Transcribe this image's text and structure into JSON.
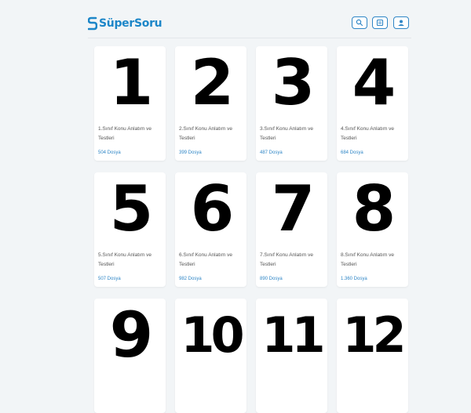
{
  "header": {
    "logo": "SüperSoru",
    "icons": [
      "search-icon",
      "document-icon",
      "user-icon"
    ],
    "accent_color": "#2f86c6"
  },
  "cards": [
    {
      "numeral": "1",
      "title": "1.Sınıf Konu Anlatım ve Testleri",
      "count": "504 Dosya"
    },
    {
      "numeral": "2",
      "title": "2.Sınıf Konu Anlatım ve Testleri",
      "count": "399 Dosya"
    },
    {
      "numeral": "3",
      "title": "3.Sınıf Konu Anlatım ve Testleri",
      "count": "487 Dosya"
    },
    {
      "numeral": "4",
      "title": "4.Sınıf Konu Anlatım ve Testleri",
      "count": "684 Dosya"
    },
    {
      "numeral": "5",
      "title": "5.Sınıf Konu Anlatım ve Testleri",
      "count": "507 Dosya"
    },
    {
      "numeral": "6",
      "title": "6.Sınıf Konu Anlatım ve Testleri",
      "count": "982 Dosya"
    },
    {
      "numeral": "7",
      "title": "7.Sınıf Konu Anlatım ve Testleri",
      "count": "890 Dosya"
    },
    {
      "numeral": "8",
      "title": "8.Sınıf Konu Anlatım ve Testleri",
      "count": "1.360 Dosya"
    },
    {
      "numeral": "9",
      "title": "",
      "count": ""
    },
    {
      "numeral": "10",
      "title": "",
      "count": ""
    },
    {
      "numeral": "11",
      "title": "",
      "count": ""
    },
    {
      "numeral": "12",
      "title": "",
      "count": ""
    }
  ]
}
